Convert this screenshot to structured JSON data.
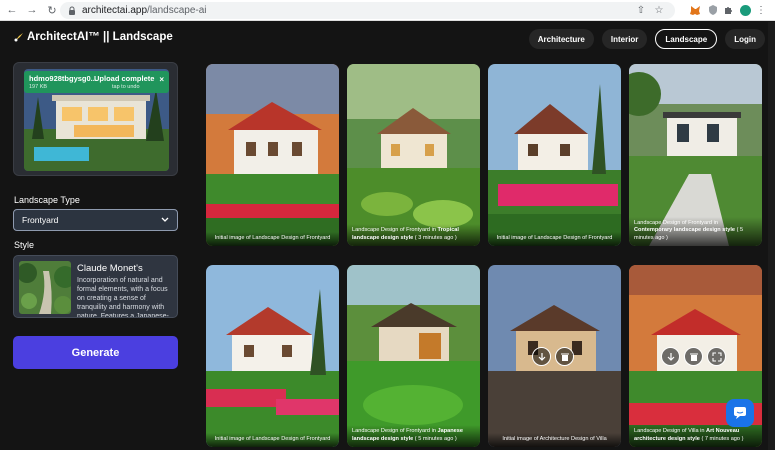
{
  "browser": {
    "url_domain": "architectai.app",
    "url_path": "/landscape-ai"
  },
  "header": {
    "brand": "ArchitectAI™ || Landscape",
    "nav": [
      {
        "label": "Architecture",
        "active": false
      },
      {
        "label": "Interior",
        "active": false
      },
      {
        "label": "Landscape",
        "active": true
      },
      {
        "label": "Login",
        "active": false
      }
    ]
  },
  "upload": {
    "filename": "hdmo928tbgysg0...",
    "filesize": "197 KB",
    "status": "Upload complete",
    "undo": "tap to undo"
  },
  "form": {
    "landscape_type_label": "Landscape Type",
    "landscape_type_value": "Frontyard",
    "style_label": "Style",
    "style_name": "Claude Monet's",
    "style_desc": "Incorporation of natural and formal elements, with a focus on creating a sense of tranquility and harmony with nature. Features a Japanese-",
    "generate_label": "Generate"
  },
  "gallery": [
    {
      "caption": "Initial image of Landscape Design of Frontyard",
      "style": "",
      "time": "",
      "center": true
    },
    {
      "caption": "Landscape Design of Frontyard in ",
      "style": "Tropical landscape design style",
      "time": " ( 3 minutes ago )",
      "center": false
    },
    {
      "caption": "Initial image of Landscape Design of Frontyard",
      "style": "",
      "time": "",
      "center": true
    },
    {
      "caption": "Landscape Design of Frontyard in ",
      "style": "Contemporary landscape design style",
      "time": " ( 5 minutes ago )",
      "center": false
    },
    {
      "caption": "Initial image of Landscape Design of Frontyard",
      "style": "",
      "time": "",
      "center": true
    },
    {
      "caption": "Landscape Design of Frontyard in ",
      "style": "Japanese landscape design style",
      "time": " ( 5 minutes ago )",
      "center": false
    },
    {
      "caption": "Initial image of Architecture Design of Villa",
      "style": "",
      "time": "",
      "center": true
    },
    {
      "caption": "Landscape Design of Villa in ",
      "style": "Art Nouveau architecture design style",
      "time": " ( 7 minutes ago )",
      "center": false
    }
  ],
  "icons": {
    "download": "download-icon",
    "delete": "trash-icon",
    "expand": "expand-icon",
    "chat": "chat-icon"
  },
  "colors": {
    "generate": "#4b3fe0",
    "toast": "#1f995a",
    "chat": "#1a73e8"
  }
}
